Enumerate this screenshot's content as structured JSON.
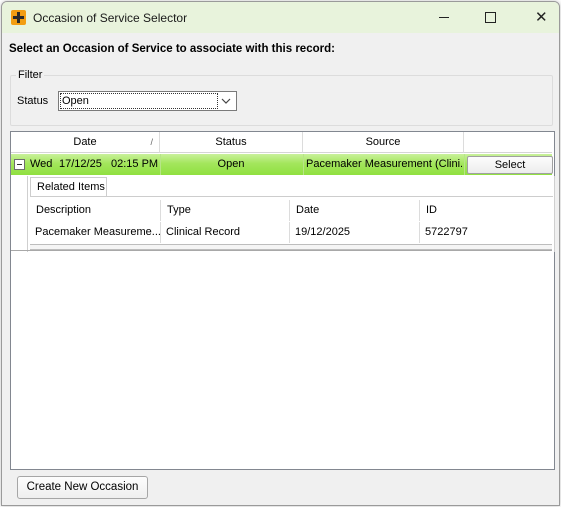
{
  "window": {
    "title": "Occasion of Service Selector",
    "accent_color": "#f29d12",
    "titlebar_color": "#e8f3dc"
  },
  "instruction": "Select an Occasion of Service to associate with this record:",
  "filter": {
    "legend": "Filter",
    "status_label": "Status",
    "status_value": "Open"
  },
  "grid": {
    "columns": [
      "Date",
      "Status",
      "Source"
    ],
    "sort_indicator": "/",
    "rows": [
      {
        "expand_symbol": "−",
        "day": "Wed",
        "date": "17/12/25",
        "time": "02:15 PM",
        "status": "Open",
        "source": "Pacemaker Measurement (Clini...",
        "action_label": "Select",
        "highlight_color": "#a3e65c"
      }
    ],
    "related": {
      "tab_label": "Related Items",
      "columns": [
        "Description",
        "Type",
        "Date",
        "ID"
      ],
      "rows": [
        {
          "description": "Pacemaker Measureme...",
          "type": "Clinical Record",
          "date": "19/12/2025",
          "id": "5722797"
        }
      ]
    }
  },
  "footer": {
    "create_label": "Create New Occasion"
  }
}
